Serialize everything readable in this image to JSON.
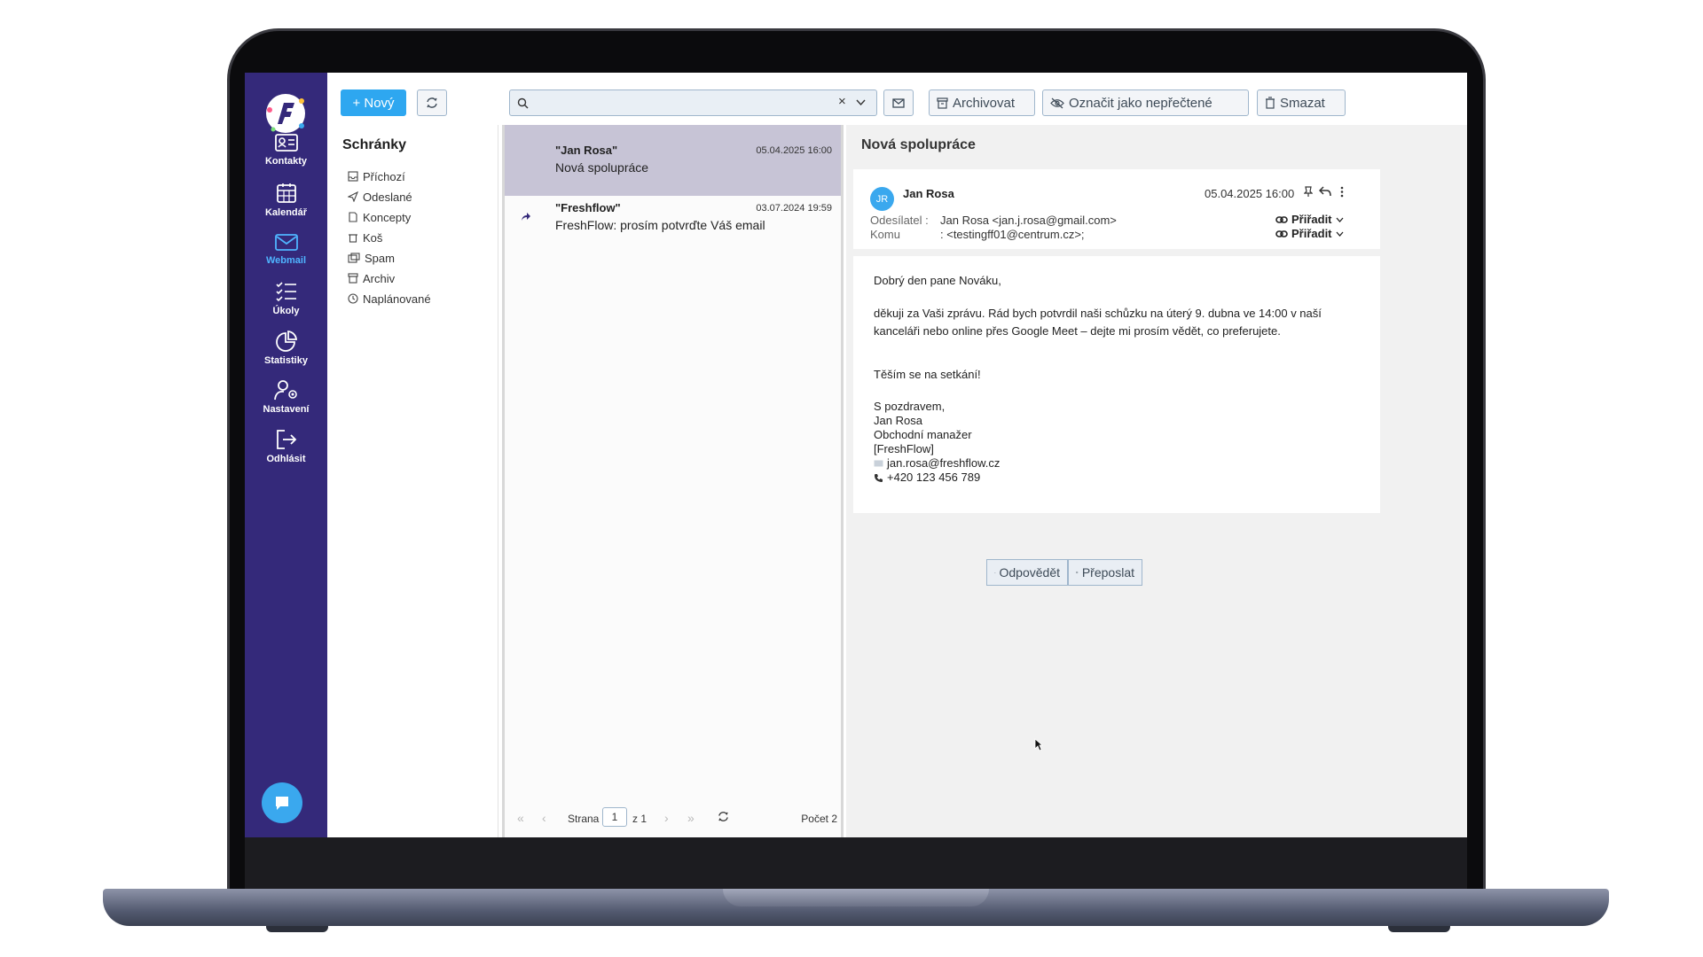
{
  "nav": [
    {
      "id": "kontakty",
      "label": "Kontakty"
    },
    {
      "id": "kalendar",
      "label": "Kalendář"
    },
    {
      "id": "webmail",
      "label": "Webmail"
    },
    {
      "id": "ukoly",
      "label": "Úkoly"
    },
    {
      "id": "statistiky",
      "label": "Statistiky"
    },
    {
      "id": "nastaveni",
      "label": "Nastavení"
    },
    {
      "id": "odhlasit",
      "label": "Odhlásit"
    }
  ],
  "toolbar": {
    "new_label": "+ Nový",
    "search_placeholder": "",
    "archive_label": "Archivovat",
    "unread_label": "Označit jako nepřečtené",
    "delete_label": "Smazat"
  },
  "mailboxes": {
    "title": "Schránky",
    "items": [
      "Příchozí",
      "Odeslané",
      "Koncepty",
      "Koš",
      "Spam",
      "Archiv",
      "Naplánované"
    ]
  },
  "messages": [
    {
      "from": "\"Jan Rosa\"",
      "subject": "Nová spolupráce",
      "date": "05.04.2025 16:00"
    },
    {
      "from": "\"Freshflow\"",
      "subject": "FreshFlow: prosím potvrďte Váš email",
      "date": "03.07.2024 19:59"
    }
  ],
  "pager": {
    "page_label": "Strana",
    "page": "1",
    "of_label": "z 1",
    "count_label": "Počet 2"
  },
  "reader": {
    "title": "Nová spolupráce",
    "avatar": "JR",
    "sender": "Jan Rosa",
    "date": "05.04.2025 16:00",
    "from_label": "Odesílatel :",
    "from_value": "Jan Rosa <jan.j.rosa@gmail.com>",
    "to_label": "Komu",
    "to_value": ": <testingff01@centrum.cz>;",
    "assign_label": "Přiřadit",
    "body": {
      "greeting": "Dobrý den pane Nováku,",
      "p1": "děkuji za Vaši zprávu. Rád bych potvrdil naši schůzku na úterý 9. dubna ve 14:00 v naší kanceláři nebo online přes Google Meet – dejte mi prosím vědět, co preferujete.",
      "p2": "Těším se na setkání!",
      "sig1": "S pozdravem,",
      "sig2": "Jan Rosa",
      "sig3": "Obchodní manažer",
      "sig4": "[FreshFlow]",
      "email": "jan.rosa@freshflow.cz",
      "phone": "+420 123 456 789"
    },
    "reply_label": "Odpovědět",
    "forward_label": "Přeposlat"
  },
  "colors": {
    "sidebar": "#34297a",
    "accent": "#2ea7f0",
    "selected": "#c7c4d6"
  }
}
